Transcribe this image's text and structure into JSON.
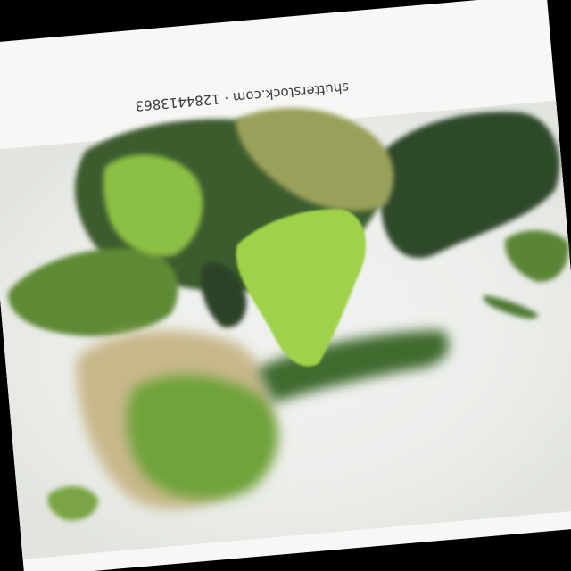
{
  "photo": {
    "watermark": "shutterstock.com · 1284413863",
    "colors": {
      "background": "#000000",
      "paper": "#f7f7f5",
      "surface": "#eef0ed",
      "dark_green": "#2f4a2a",
      "mid_green": "#5e8a35",
      "light_green": "#9fd24a",
      "olive": "#9aa05a",
      "tan": "#c8b88a"
    }
  }
}
